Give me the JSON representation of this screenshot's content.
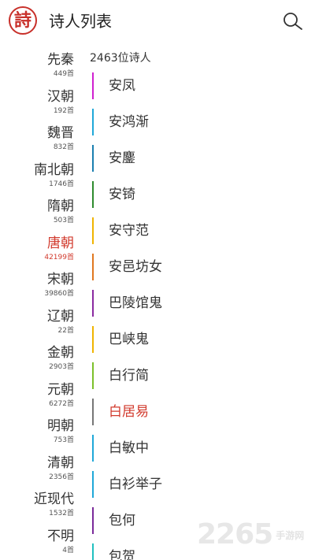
{
  "header": {
    "logo_char": "詩",
    "title": "诗人列表",
    "search_icon": "search-icon"
  },
  "colors": {
    "accent": "#d23b2e",
    "logo": "#c8302a"
  },
  "dynasties": [
    {
      "name": "先秦",
      "count": "449首"
    },
    {
      "name": "汉朝",
      "count": "192首"
    },
    {
      "name": "魏晋",
      "count": "832首"
    },
    {
      "name": "南北朝",
      "count": "1746首"
    },
    {
      "name": "隋朝",
      "count": "503首"
    },
    {
      "name": "唐朝",
      "count": "42199首",
      "active": true
    },
    {
      "name": "宋朝",
      "count": "39860首"
    },
    {
      "name": "辽朝",
      "count": "22首"
    },
    {
      "name": "金朝",
      "count": "2903首"
    },
    {
      "name": "元朝",
      "count": "6272首"
    },
    {
      "name": "明朝",
      "count": "753首"
    },
    {
      "name": "清朝",
      "count": "2356首"
    },
    {
      "name": "近现代",
      "count": "1532首"
    },
    {
      "name": "不明",
      "count": "4首"
    }
  ],
  "poet_count_label": "2463位诗人",
  "poets": [
    {
      "name": "安凤",
      "color": "#d020d0"
    },
    {
      "name": "安鸿渐",
      "color": "#1fa8d8"
    },
    {
      "name": "安鏖",
      "color": "#1a7fb0"
    },
    {
      "name": "安锜",
      "color": "#2e8b2e"
    },
    {
      "name": "安守范",
      "color": "#f0b400"
    },
    {
      "name": "安邑坊女",
      "color": "#e07820"
    },
    {
      "name": "巴陵馆鬼",
      "color": "#8a2aa0"
    },
    {
      "name": "巴峡鬼",
      "color": "#f0b400"
    },
    {
      "name": "白行简",
      "color": "#7cc02a"
    },
    {
      "name": "白居易",
      "color": "#777777",
      "active": true
    },
    {
      "name": "白敏中",
      "color": "#1fa8d8"
    },
    {
      "name": "白衫举子",
      "color": "#1fa8d8"
    },
    {
      "name": "包何",
      "color": "#7a2a9a"
    },
    {
      "name": "包贺",
      "color": "#20c0c0"
    }
  ],
  "watermark": {
    "number": "2265",
    "site": "手游网"
  }
}
